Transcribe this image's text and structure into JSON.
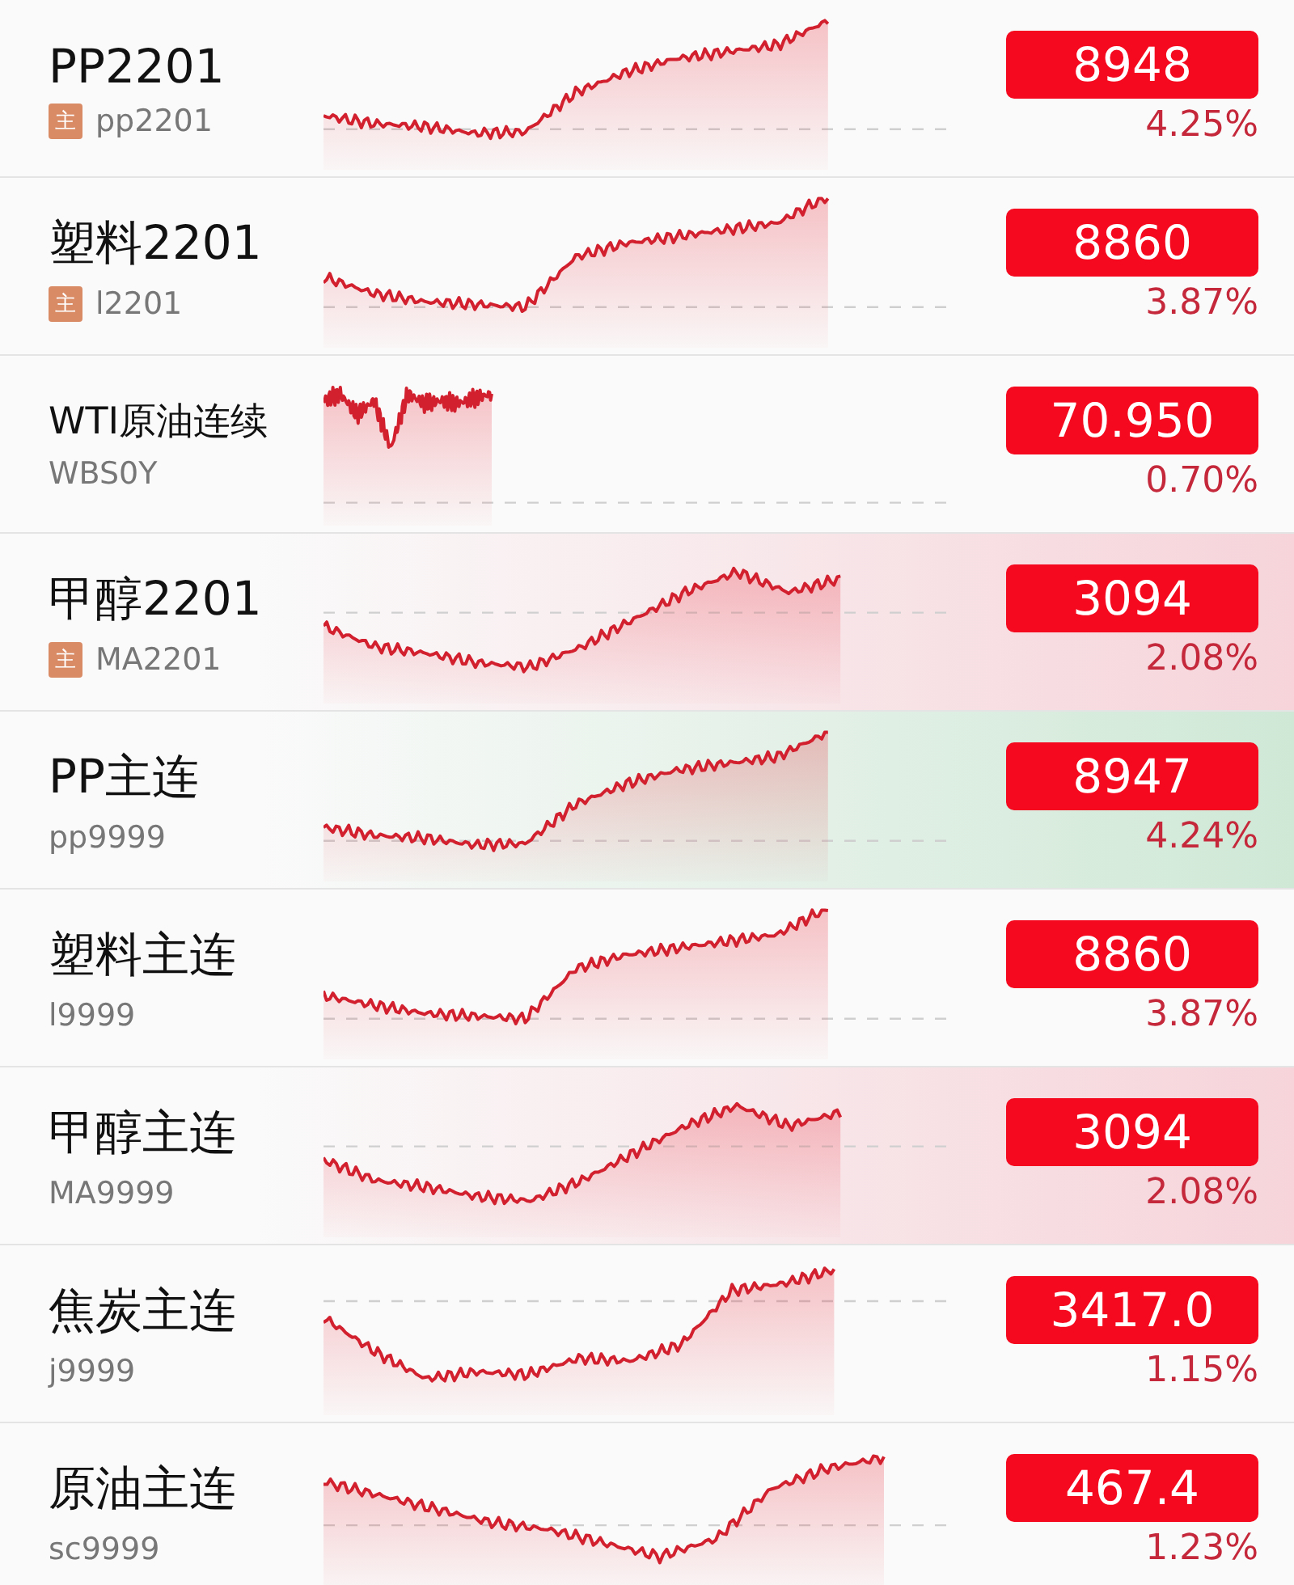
{
  "quotes": [
    {
      "name": "PP2201",
      "badge": "主",
      "code": "pp2201",
      "price": "8948",
      "change": "4.25%",
      "flash_up": false,
      "flash_down": false
    },
    {
      "name": "塑料2201",
      "badge": "主",
      "code": "l2201",
      "price": "8860",
      "change": "3.87%",
      "flash_up": false,
      "flash_down": false
    },
    {
      "name": "WTI原油连续",
      "code": "WBS0Y",
      "price": "70.950",
      "change": "0.70%",
      "flash_up": false,
      "flash_down": false
    },
    {
      "name": "甲醇2201",
      "badge": "主",
      "code": "MA2201",
      "price": "3094",
      "change": "2.08%",
      "flash_up": true,
      "flash_down": false
    },
    {
      "name": "PP主连",
      "code": "pp9999",
      "price": "8947",
      "change": "4.24%",
      "flash_up": false,
      "flash_down": true
    },
    {
      "name": "塑料主连",
      "code": "l9999",
      "price": "8860",
      "change": "3.87%",
      "flash_up": false,
      "flash_down": false
    },
    {
      "name": "甲醇主连",
      "code": "MA9999",
      "price": "3094",
      "change": "2.08%",
      "flash_up": true,
      "flash_down": false
    },
    {
      "name": "焦炭主连",
      "code": "j9999",
      "price": "3417.0",
      "change": "1.15%",
      "flash_up": false,
      "flash_down": false
    },
    {
      "name": "原油主连",
      "code": "sc9999",
      "price": "467.4",
      "change": "1.23%",
      "flash_up": false,
      "flash_down": false
    }
  ]
}
